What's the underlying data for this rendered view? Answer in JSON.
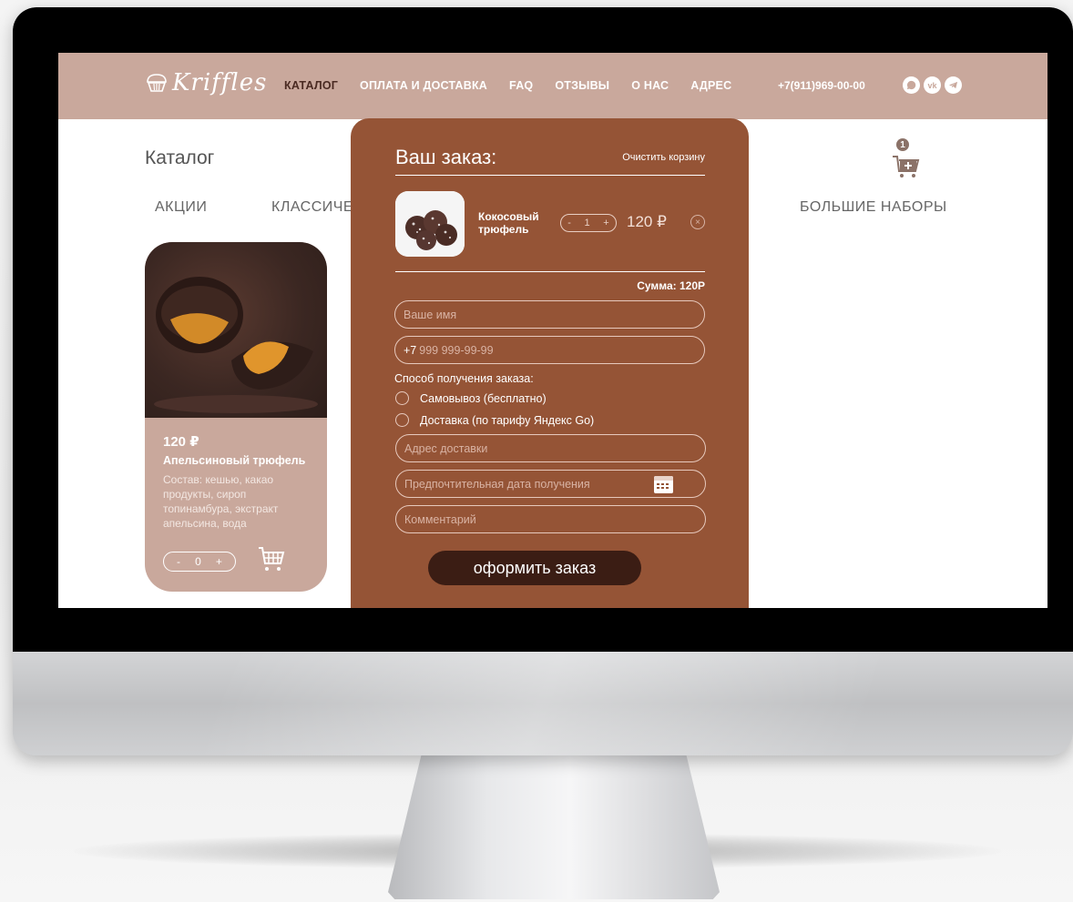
{
  "header": {
    "logo_text": "Kriffles",
    "nav": [
      "КАТАЛОГ",
      "ОПЛАТА И ДОСТАВКА",
      "FAQ",
      "ОТЗЫВЫ",
      "О НАС",
      "АДРЕС"
    ],
    "phone": "+7(911)969-00-00",
    "socials": [
      "whatsapp-icon",
      "vk-icon",
      "telegram-icon"
    ],
    "vk_label": "vk"
  },
  "catalog": {
    "title": "Каталог",
    "tabs": [
      "АКЦИИ",
      "КЛАССИЧЕ",
      "БОЛЬШИЕ НАБОРЫ"
    ],
    "cart_count": "1"
  },
  "product": {
    "price": "120 ₽",
    "name": "Апельсиновый трюфель",
    "description": "Состав: кешью, какао продукты, сироп топинамбура, экстракт апельсина, вода",
    "stepper": {
      "minus": "-",
      "qty": "0",
      "plus": "+"
    }
  },
  "order": {
    "title": "Ваш заказ:",
    "clear_label": "Очистить корзину",
    "item": {
      "name": "Кокосовый трюфель",
      "stepper": {
        "minus": "-",
        "qty": "1",
        "plus": "+"
      },
      "price": "120 ₽",
      "remove": "×"
    },
    "sum_label": "Сумма: 120Р",
    "fields": {
      "name_placeholder": "Ваше имя",
      "phone_prefix": "+7",
      "phone_placeholder": "999 999-99-99",
      "address_placeholder": "Адрес доставки",
      "date_placeholder": "Предпочтительная дата получения",
      "comment_placeholder": "Комментарий"
    },
    "delivery_label": "Способ получения заказа:",
    "delivery_options": [
      "Самовывоз (бесплатно)",
      "Доставка (по тарифу Яндекс Go)"
    ],
    "submit_label": "оформить заказ"
  }
}
